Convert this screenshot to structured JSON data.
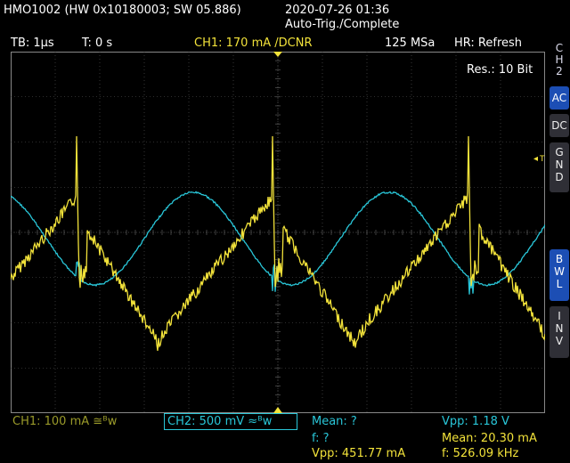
{
  "title": {
    "device": "HMO1002 (HW 0x10180003; SW 05.886)",
    "datetime": "2020-07-26 01:36",
    "trigger_status": "Auto-Trig./Complete"
  },
  "info_bar": {
    "timebase": "TB: 1µs",
    "trigger_time": "T: 0 s",
    "ch1_trigger": "CH1: 170 mA /DCNR",
    "sample_rate": "125 MSa",
    "hr_mode": "HR: Refresh"
  },
  "resolution": "Res.: 10 Bit",
  "side_menu": {
    "channel": [
      "C",
      "H",
      "2"
    ],
    "buttons": [
      {
        "label": "AC",
        "active": true
      },
      {
        "label": "DC",
        "active": false
      },
      {
        "label": "G N D",
        "active": false
      },
      {
        "label": "B W L",
        "active": true
      },
      {
        "label": "I N V",
        "active": false
      }
    ]
  },
  "markers": {
    "trigger_level": "T",
    "ch2_ground": "2"
  },
  "status": {
    "ch1_setting": "CH1: 100 mA ≅ᴮw",
    "ch2_setting": "CH2: 500 mV ≈ᴮw",
    "ch1_meas": {
      "mean": "Mean: ?",
      "f": "f: ?",
      "vpp": "Vpp: 451.77 mA"
    },
    "ch2_meas": {
      "vpp": "Vpp: 1.18 V",
      "mean": "Mean: 20.30 mA",
      "f": "f: 526.09 kHz"
    }
  },
  "colors": {
    "ch1": "#f2e23a",
    "ch2": "#29c6d8",
    "grid": "#5a5a5a",
    "active_button": "#1c4eb4"
  }
}
